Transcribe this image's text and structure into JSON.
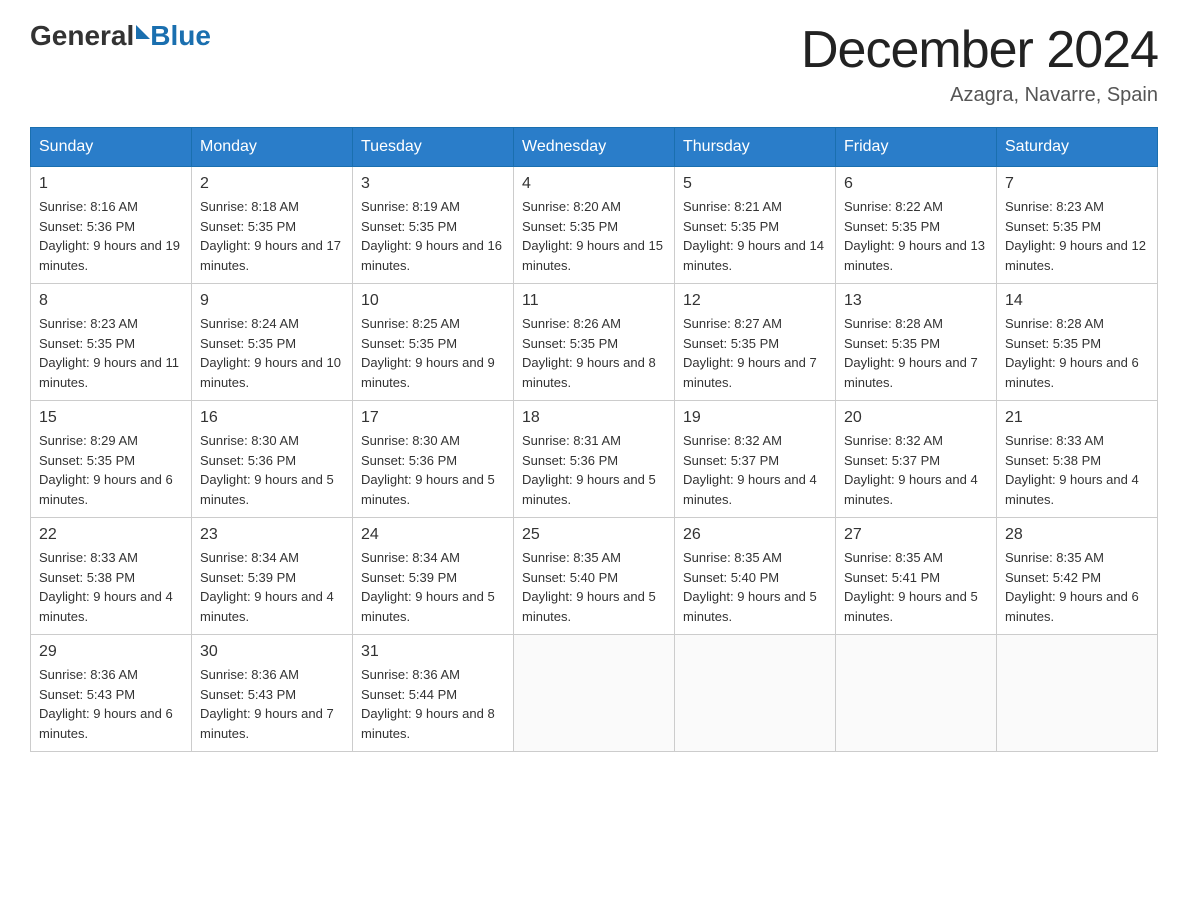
{
  "logo": {
    "general": "General",
    "blue": "Blue",
    "tagline": ""
  },
  "title": "December 2024",
  "location": "Azagra, Navarre, Spain",
  "headers": [
    "Sunday",
    "Monday",
    "Tuesday",
    "Wednesday",
    "Thursday",
    "Friday",
    "Saturday"
  ],
  "weeks": [
    [
      {
        "day": "1",
        "sunrise": "8:16 AM",
        "sunset": "5:36 PM",
        "daylight": "9 hours and 19 minutes."
      },
      {
        "day": "2",
        "sunrise": "8:18 AM",
        "sunset": "5:35 PM",
        "daylight": "9 hours and 17 minutes."
      },
      {
        "day": "3",
        "sunrise": "8:19 AM",
        "sunset": "5:35 PM",
        "daylight": "9 hours and 16 minutes."
      },
      {
        "day": "4",
        "sunrise": "8:20 AM",
        "sunset": "5:35 PM",
        "daylight": "9 hours and 15 minutes."
      },
      {
        "day": "5",
        "sunrise": "8:21 AM",
        "sunset": "5:35 PM",
        "daylight": "9 hours and 14 minutes."
      },
      {
        "day": "6",
        "sunrise": "8:22 AM",
        "sunset": "5:35 PM",
        "daylight": "9 hours and 13 minutes."
      },
      {
        "day": "7",
        "sunrise": "8:23 AM",
        "sunset": "5:35 PM",
        "daylight": "9 hours and 12 minutes."
      }
    ],
    [
      {
        "day": "8",
        "sunrise": "8:23 AM",
        "sunset": "5:35 PM",
        "daylight": "9 hours and 11 minutes."
      },
      {
        "day": "9",
        "sunrise": "8:24 AM",
        "sunset": "5:35 PM",
        "daylight": "9 hours and 10 minutes."
      },
      {
        "day": "10",
        "sunrise": "8:25 AM",
        "sunset": "5:35 PM",
        "daylight": "9 hours and 9 minutes."
      },
      {
        "day": "11",
        "sunrise": "8:26 AM",
        "sunset": "5:35 PM",
        "daylight": "9 hours and 8 minutes."
      },
      {
        "day": "12",
        "sunrise": "8:27 AM",
        "sunset": "5:35 PM",
        "daylight": "9 hours and 7 minutes."
      },
      {
        "day": "13",
        "sunrise": "8:28 AM",
        "sunset": "5:35 PM",
        "daylight": "9 hours and 7 minutes."
      },
      {
        "day": "14",
        "sunrise": "8:28 AM",
        "sunset": "5:35 PM",
        "daylight": "9 hours and 6 minutes."
      }
    ],
    [
      {
        "day": "15",
        "sunrise": "8:29 AM",
        "sunset": "5:35 PM",
        "daylight": "9 hours and 6 minutes."
      },
      {
        "day": "16",
        "sunrise": "8:30 AM",
        "sunset": "5:36 PM",
        "daylight": "9 hours and 5 minutes."
      },
      {
        "day": "17",
        "sunrise": "8:30 AM",
        "sunset": "5:36 PM",
        "daylight": "9 hours and 5 minutes."
      },
      {
        "day": "18",
        "sunrise": "8:31 AM",
        "sunset": "5:36 PM",
        "daylight": "9 hours and 5 minutes."
      },
      {
        "day": "19",
        "sunrise": "8:32 AM",
        "sunset": "5:37 PM",
        "daylight": "9 hours and 4 minutes."
      },
      {
        "day": "20",
        "sunrise": "8:32 AM",
        "sunset": "5:37 PM",
        "daylight": "9 hours and 4 minutes."
      },
      {
        "day": "21",
        "sunrise": "8:33 AM",
        "sunset": "5:38 PM",
        "daylight": "9 hours and 4 minutes."
      }
    ],
    [
      {
        "day": "22",
        "sunrise": "8:33 AM",
        "sunset": "5:38 PM",
        "daylight": "9 hours and 4 minutes."
      },
      {
        "day": "23",
        "sunrise": "8:34 AM",
        "sunset": "5:39 PM",
        "daylight": "9 hours and 4 minutes."
      },
      {
        "day": "24",
        "sunrise": "8:34 AM",
        "sunset": "5:39 PM",
        "daylight": "9 hours and 5 minutes."
      },
      {
        "day": "25",
        "sunrise": "8:35 AM",
        "sunset": "5:40 PM",
        "daylight": "9 hours and 5 minutes."
      },
      {
        "day": "26",
        "sunrise": "8:35 AM",
        "sunset": "5:40 PM",
        "daylight": "9 hours and 5 minutes."
      },
      {
        "day": "27",
        "sunrise": "8:35 AM",
        "sunset": "5:41 PM",
        "daylight": "9 hours and 5 minutes."
      },
      {
        "day": "28",
        "sunrise": "8:35 AM",
        "sunset": "5:42 PM",
        "daylight": "9 hours and 6 minutes."
      }
    ],
    [
      {
        "day": "29",
        "sunrise": "8:36 AM",
        "sunset": "5:43 PM",
        "daylight": "9 hours and 6 minutes."
      },
      {
        "day": "30",
        "sunrise": "8:36 AM",
        "sunset": "5:43 PM",
        "daylight": "9 hours and 7 minutes."
      },
      {
        "day": "31",
        "sunrise": "8:36 AM",
        "sunset": "5:44 PM",
        "daylight": "9 hours and 8 minutes."
      },
      null,
      null,
      null,
      null
    ]
  ]
}
